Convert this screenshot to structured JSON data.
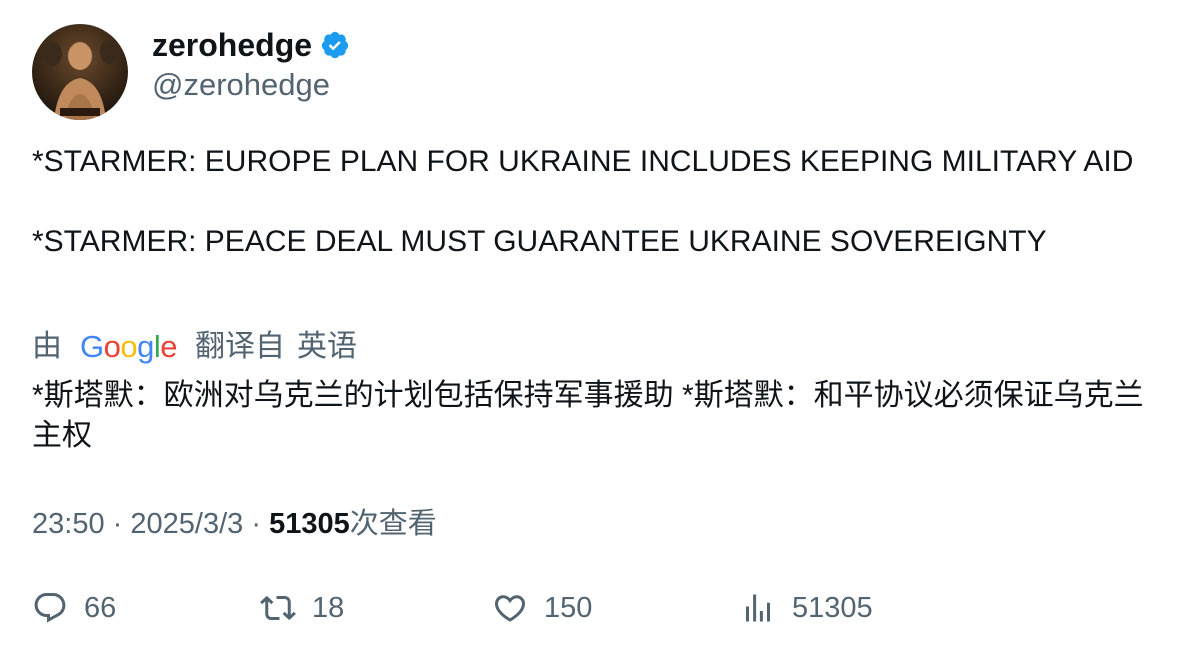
{
  "author": {
    "display_name": "zerohedge",
    "handle": "@zerohedge",
    "verified": true,
    "verified_color": "#1d9bf0"
  },
  "tweet": {
    "lines": [
      "*STARMER: EUROPE PLAN FOR UKRAINE INCLUDES KEEPING MILITARY AID",
      "*STARMER: PEACE DEAL MUST GUARANTEE UKRAINE SOVEREIGNTY"
    ]
  },
  "translation": {
    "by_label": "由",
    "provider": "Google",
    "from_label": "翻译自",
    "source_language": "英语",
    "text": "*斯塔默：欧洲对乌克兰的计划包括保持军事援助 *斯塔默：和平协议必须保证乌克兰主权"
  },
  "meta": {
    "time": "23:50",
    "separator": "·",
    "date": "2025/3/3",
    "views": "51305",
    "views_label": "次查看"
  },
  "actions": {
    "replies": "66",
    "retweets": "18",
    "likes": "150",
    "views": "51305"
  }
}
